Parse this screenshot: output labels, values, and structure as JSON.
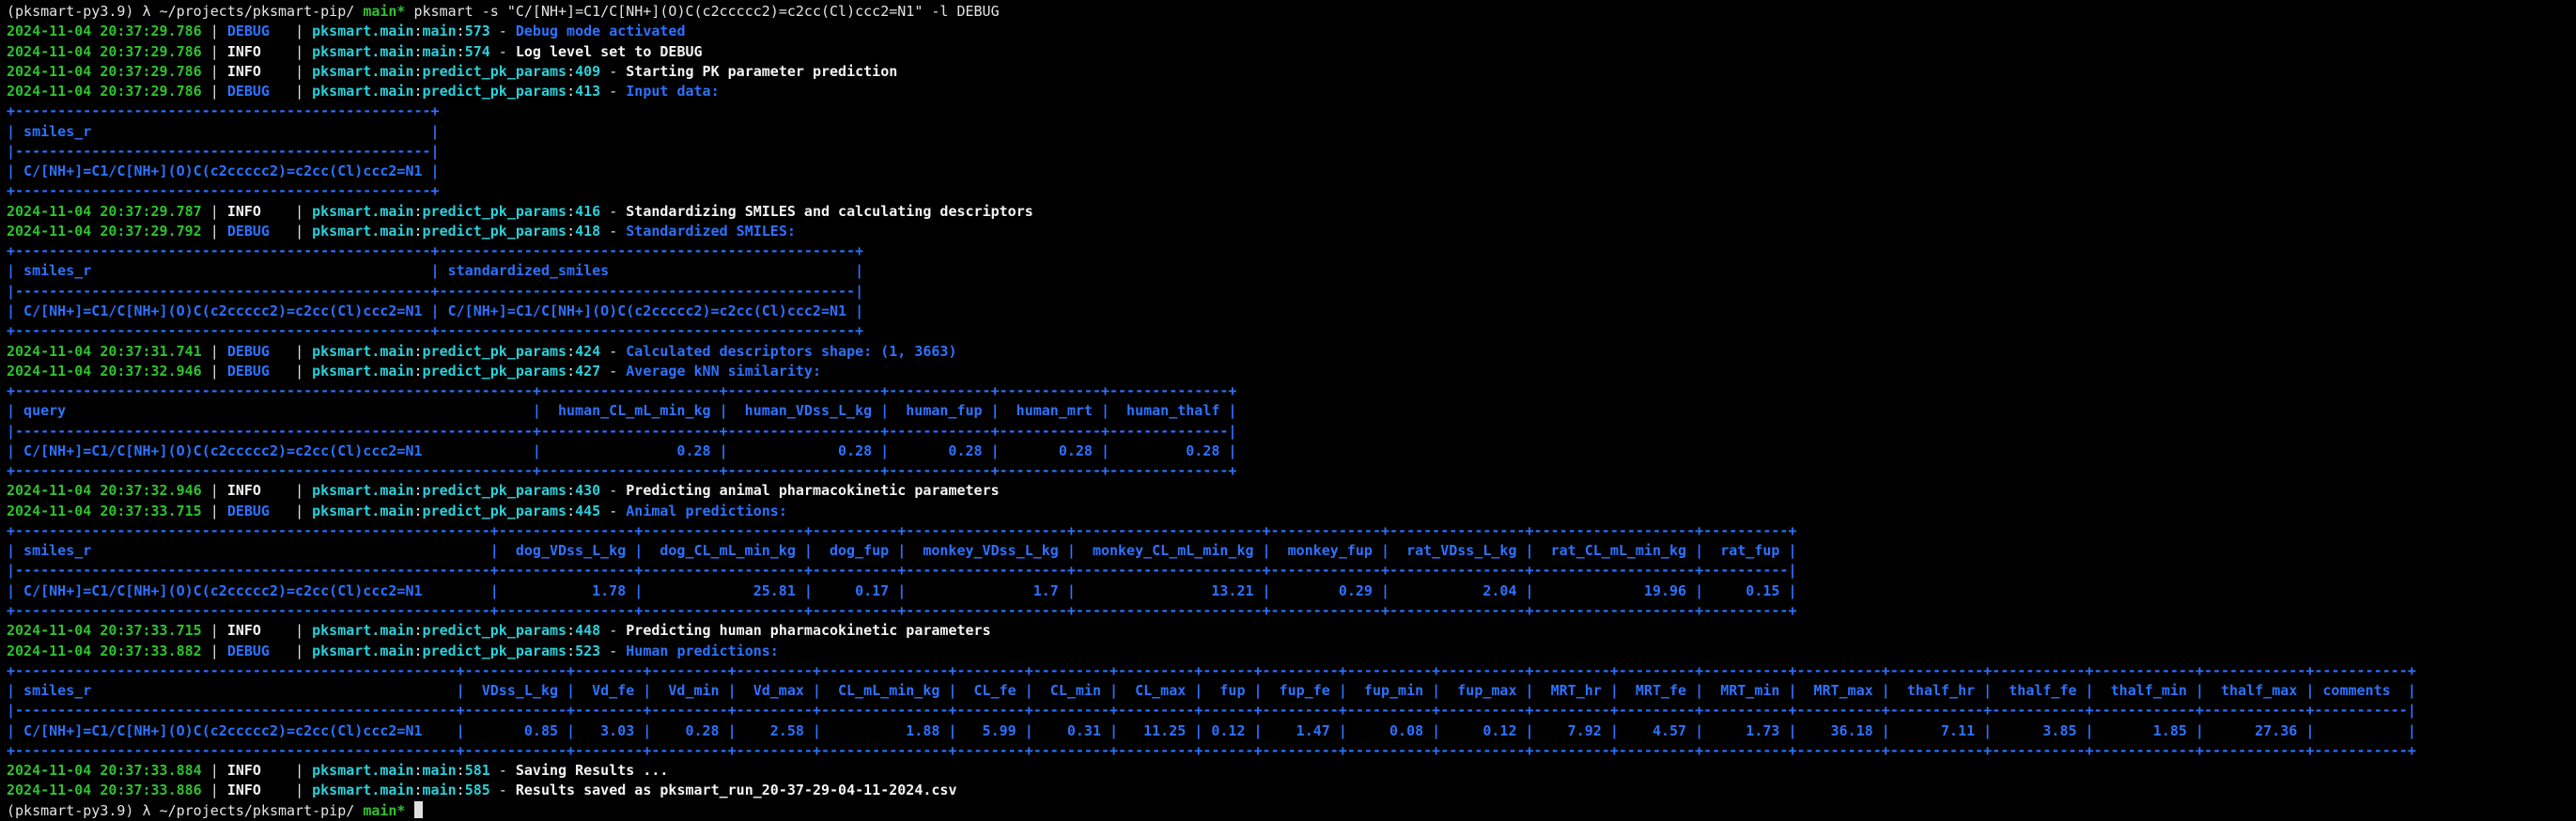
{
  "colors": {
    "background": "#000000",
    "timestamp_green": "#2ec22e",
    "debug_blue": "#2d72ff",
    "location_cyan": "#2bd0da",
    "info_white": "#f5f5f5",
    "table_blue": "#2d72ff"
  },
  "prompt": {
    "venv": "(pksmart-py3.9)",
    "lambda": "λ",
    "path": "~/projects/pksmart-pip/",
    "branch": "main*"
  },
  "command": "pksmart -s \"C/[NH+]=C1/C[NH+](O)C(c2ccccc2)=c2cc(Cl)ccc2=N1\" -l DEBUG",
  "smiles": "C/[NH+]=C1/C[NH+](O)C(c2ccccc2)=c2cc(Cl)ccc2=N1",
  "tables": {
    "input": {
      "cols": [
        {
          "h": "smiles_r",
          "w": 49,
          "a": "l"
        }
      ],
      "rows": [
        [
          "C/[NH+]=C1/C[NH+](O)C(c2ccccc2)=c2cc(Cl)ccc2=N1"
        ]
      ]
    },
    "standardized": {
      "cols": [
        {
          "h": "smiles_r",
          "w": 49,
          "a": "l"
        },
        {
          "h": "standardized_smiles",
          "w": 49,
          "a": "l"
        }
      ],
      "rows": [
        [
          "C/[NH+]=C1/C[NH+](O)C(c2ccccc2)=c2cc(Cl)ccc2=N1",
          "C/[NH+]=C1/C[NH+](O)C(c2ccccc2)=c2cc(Cl)ccc2=N1"
        ]
      ]
    },
    "similarity": {
      "cols": [
        {
          "h": "query",
          "w": 61,
          "a": "l"
        },
        {
          "h": "human_CL_mL_min_kg",
          "w": 21,
          "a": "r"
        },
        {
          "h": "human_VDss_L_kg",
          "w": 18,
          "a": "r"
        },
        {
          "h": "human_fup",
          "w": 12,
          "a": "r"
        },
        {
          "h": "human_mrt",
          "w": 12,
          "a": "r"
        },
        {
          "h": "human_thalf",
          "w": 14,
          "a": "r"
        }
      ],
      "rows": [
        [
          "C/[NH+]=C1/C[NH+](O)C(c2ccccc2)=c2cc(Cl)ccc2=N1",
          "0.28",
          "0.28",
          "0.28",
          "0.28",
          "0.28"
        ]
      ]
    },
    "animal": {
      "cols": [
        {
          "h": "smiles_r",
          "w": 56,
          "a": "l"
        },
        {
          "h": "dog_VDss_L_kg",
          "w": 16,
          "a": "r"
        },
        {
          "h": "dog_CL_mL_min_kg",
          "w": 19,
          "a": "r"
        },
        {
          "h": "dog_fup",
          "w": 10,
          "a": "r"
        },
        {
          "h": "monkey_VDss_L_kg",
          "w": 19,
          "a": "r"
        },
        {
          "h": "monkey_CL_mL_min_kg",
          "w": 22,
          "a": "r"
        },
        {
          "h": "monkey_fup",
          "w": 13,
          "a": "r"
        },
        {
          "h": "rat_VDss_L_kg",
          "w": 16,
          "a": "r"
        },
        {
          "h": "rat_CL_mL_min_kg",
          "w": 19,
          "a": "r"
        },
        {
          "h": "rat_fup",
          "w": 10,
          "a": "r"
        }
      ],
      "rows": [
        [
          "C/[NH+]=C1/C[NH+](O)C(c2ccccc2)=c2cc(Cl)ccc2=N1",
          "1.78",
          "25.81",
          "0.17",
          "1.7",
          "13.21",
          "0.29",
          "2.04",
          "19.96",
          "0.15"
        ]
      ]
    },
    "human": {
      "cols": [
        {
          "h": "smiles_r",
          "w": 52,
          "a": "l"
        },
        {
          "h": "VDss_L_kg",
          "w": 12,
          "a": "r"
        },
        {
          "h": "Vd_fe",
          "w": 8,
          "a": "r"
        },
        {
          "h": "Vd_min",
          "w": 9,
          "a": "r"
        },
        {
          "h": "Vd_max",
          "w": 9,
          "a": "r"
        },
        {
          "h": "CL_mL_min_kg",
          "w": 15,
          "a": "r"
        },
        {
          "h": "CL_fe",
          "w": 8,
          "a": "r"
        },
        {
          "h": "CL_min",
          "w": 9,
          "a": "r"
        },
        {
          "h": "CL_max",
          "w": 9,
          "a": "r"
        },
        {
          "h": "fup",
          "w": 6,
          "a": "r"
        },
        {
          "h": "fup_fe",
          "w": 9,
          "a": "r"
        },
        {
          "h": "fup_min",
          "w": 10,
          "a": "r"
        },
        {
          "h": "fup_max",
          "w": 10,
          "a": "r"
        },
        {
          "h": "MRT_hr",
          "w": 9,
          "a": "r"
        },
        {
          "h": "MRT_fe",
          "w": 9,
          "a": "r"
        },
        {
          "h": "MRT_min",
          "w": 10,
          "a": "r"
        },
        {
          "h": "MRT_max",
          "w": 10,
          "a": "r"
        },
        {
          "h": "thalf_hr",
          "w": 11,
          "a": "r"
        },
        {
          "h": "thalf_fe",
          "w": 11,
          "a": "r"
        },
        {
          "h": "thalf_min",
          "w": 12,
          "a": "r"
        },
        {
          "h": "thalf_max",
          "w": 12,
          "a": "r"
        },
        {
          "h": "comments",
          "w": 11,
          "a": "l"
        }
      ],
      "rows": [
        [
          "C/[NH+]=C1/C[NH+](O)C(c2ccccc2)=c2cc(Cl)ccc2=N1",
          "0.85",
          "3.03",
          "0.28",
          "2.58",
          "1.88",
          "5.99",
          "0.31",
          "11.25",
          "0.12",
          "1.47",
          "0.08",
          "0.12",
          "7.92",
          "4.57",
          "1.73",
          "36.18",
          "7.11",
          "3.85",
          "1.85",
          "27.36",
          ""
        ]
      ]
    }
  },
  "lines": [
    {
      "type": "prompt",
      "show_command": true,
      "cursor": false
    },
    {
      "type": "log",
      "ts": "2024-11-04 20:37:29.786",
      "level": "DEBUG",
      "loc": "pksmart.main:main:573",
      "msg": "Debug mode activated"
    },
    {
      "type": "log",
      "ts": "2024-11-04 20:37:29.786",
      "level": "INFO",
      "loc": "pksmart.main:main:574",
      "msg": "Log level set to DEBUG"
    },
    {
      "type": "log",
      "ts": "2024-11-04 20:37:29.786",
      "level": "INFO",
      "loc": "pksmart.main:predict_pk_params:409",
      "msg": "Starting PK parameter prediction"
    },
    {
      "type": "log",
      "ts": "2024-11-04 20:37:29.786",
      "level": "DEBUG",
      "loc": "pksmart.main:predict_pk_params:413",
      "msg": "Input data:"
    },
    {
      "type": "table",
      "id": "input"
    },
    {
      "type": "log",
      "ts": "2024-11-04 20:37:29.787",
      "level": "INFO",
      "loc": "pksmart.main:predict_pk_params:416",
      "msg": "Standardizing SMILES and calculating descriptors"
    },
    {
      "type": "log",
      "ts": "2024-11-04 20:37:29.792",
      "level": "DEBUG",
      "loc": "pksmart.main:predict_pk_params:418",
      "msg": "Standardized SMILES:"
    },
    {
      "type": "table",
      "id": "standardized"
    },
    {
      "type": "log",
      "ts": "2024-11-04 20:37:31.741",
      "level": "DEBUG",
      "loc": "pksmart.main:predict_pk_params:424",
      "msg": "Calculated descriptors shape: (1, 3663)"
    },
    {
      "type": "log",
      "ts": "2024-11-04 20:37:32.946",
      "level": "DEBUG",
      "loc": "pksmart.main:predict_pk_params:427",
      "msg": "Average kNN similarity:"
    },
    {
      "type": "table",
      "id": "similarity"
    },
    {
      "type": "log",
      "ts": "2024-11-04 20:37:32.946",
      "level": "INFO",
      "loc": "pksmart.main:predict_pk_params:430",
      "msg": "Predicting animal pharmacokinetic parameters"
    },
    {
      "type": "log",
      "ts": "2024-11-04 20:37:33.715",
      "level": "DEBUG",
      "loc": "pksmart.main:predict_pk_params:445",
      "msg": "Animal predictions:"
    },
    {
      "type": "table",
      "id": "animal"
    },
    {
      "type": "log",
      "ts": "2024-11-04 20:37:33.715",
      "level": "INFO",
      "loc": "pksmart.main:predict_pk_params:448",
      "msg": "Predicting human pharmacokinetic parameters"
    },
    {
      "type": "log",
      "ts": "2024-11-04 20:37:33.882",
      "level": "DEBUG",
      "loc": "pksmart.main:predict_pk_params:523",
      "msg": "Human predictions:"
    },
    {
      "type": "table",
      "id": "human"
    },
    {
      "type": "log",
      "ts": "2024-11-04 20:37:33.884",
      "level": "INFO",
      "loc": "pksmart.main:main:581",
      "msg": "Saving Results ..."
    },
    {
      "type": "log",
      "ts": "2024-11-04 20:37:33.886",
      "level": "INFO",
      "loc": "pksmart.main:main:585",
      "msg": "Results saved as pksmart_run_20-37-29-04-11-2024.csv"
    },
    {
      "type": "prompt",
      "show_command": false,
      "cursor": true
    }
  ]
}
